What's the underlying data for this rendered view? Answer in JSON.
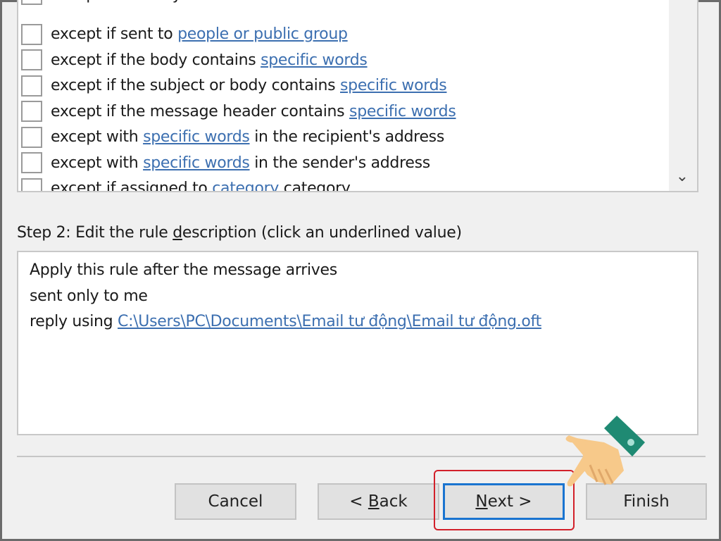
{
  "conditions": [
    {
      "pre": "except where my name is not in the To box",
      "link": "",
      "post": ""
    },
    {
      "pre": "except if sent to ",
      "link": "people or public group",
      "post": ""
    },
    {
      "pre": "except if the body contains ",
      "link": "specific words",
      "post": ""
    },
    {
      "pre": "except if the subject or body contains ",
      "link": "specific words",
      "post": ""
    },
    {
      "pre": "except if the message header contains ",
      "link": "specific words",
      "post": ""
    },
    {
      "pre": "except with ",
      "link": "specific words",
      "post": " in the recipient's address"
    },
    {
      "pre": "except with ",
      "link": "specific words",
      "post": " in the sender's address"
    },
    {
      "pre": "except if assigned to ",
      "link": "category",
      "post": " category"
    }
  ],
  "step2": {
    "pre": "Step 2: Edit the rule ",
    "u": "d",
    "post": "escription (click an underlined value)"
  },
  "description": {
    "line1": "Apply this rule after the message arrives",
    "line2": "sent only to me",
    "line3_pre": "reply using ",
    "line3_link": "C:\\Users\\PC\\Documents\\Email tư động\\Email tư động.oft"
  },
  "buttons": {
    "cancel": "Cancel",
    "back_pre": "< ",
    "back_u": "B",
    "back_post": "ack",
    "next_u": "N",
    "next_post": "ext >",
    "finish": "Finish"
  },
  "colors": {
    "link": "#3c6fb0",
    "highlight": "#d2202a",
    "default_button": "#1a74d0"
  },
  "icons": {
    "scroll": "chevron-down-icon",
    "pointer": "pointing-hand-icon"
  }
}
